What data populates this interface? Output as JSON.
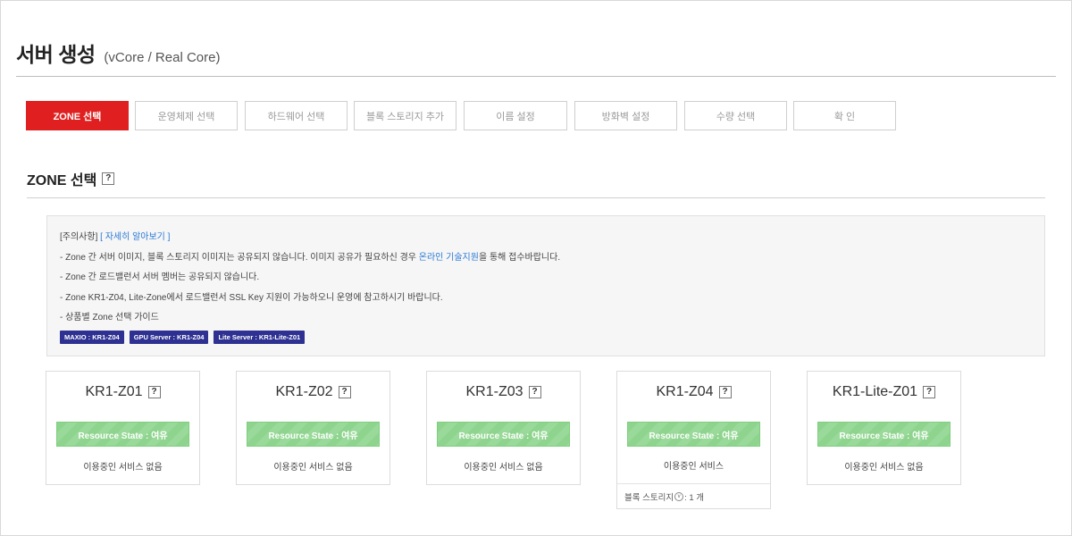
{
  "header": {
    "title": "서버 생성",
    "subtitle": "(vCore / Real Core)"
  },
  "steps": [
    {
      "label": "ZONE 선택",
      "active": true
    },
    {
      "label": "운영체제 선택",
      "active": false
    },
    {
      "label": "하드웨어 선택",
      "active": false
    },
    {
      "label": "블록 스토리지 추가",
      "active": false
    },
    {
      "label": "이름 설정",
      "active": false
    },
    {
      "label": "방화벽 설정",
      "active": false
    },
    {
      "label": "수량 선택",
      "active": false
    },
    {
      "label": "확 인",
      "active": false
    }
  ],
  "section": {
    "title": "ZONE 선택",
    "help": "?"
  },
  "notice": {
    "heading": "[주의사항]",
    "more_link": "[ 자세히 알아보기 ]",
    "line1_a": "- Zone 간 서버 이미지, 블록 스토리지 이미지는 공유되지 않습니다. 이미지 공유가 필요하신 경우 ",
    "line1_link": "온라인 기술지원",
    "line1_b": "을 통해 접수바랍니다.",
    "line2": "- Zone 간 로드밸런서 서버 멤버는 공유되지 않습니다.",
    "line3": "- Zone KR1-Z04, Lite-Zone에서 로드밸런서 SSL Key 지원이 가능하오니 운영에 참고하시기 바랍니다.",
    "line4": "- 상품별 Zone 선택 가이드",
    "badges": [
      "MAXIO : KR1-Z04",
      "GPU Server : KR1-Z04",
      "Lite Server : KR1-Lite-Z01"
    ]
  },
  "zones": [
    {
      "name": "KR1-Z01",
      "help": "?",
      "state": "Resource State : 여유",
      "service": "이용중인 서비스 없음"
    },
    {
      "name": "KR1-Z02",
      "help": "?",
      "state": "Resource State : 여유",
      "service": "이용중인 서비스 없음"
    },
    {
      "name": "KR1-Z03",
      "help": "?",
      "state": "Resource State : 여유",
      "service": "이용중인 서비스 없음"
    },
    {
      "name": "KR1-Z04",
      "help": "?",
      "state": "Resource State : 여유",
      "service": "이용중인 서비스",
      "extra_label": "블록 스토리지",
      "extra_icon": "v",
      "extra_value": ": 1 개"
    },
    {
      "name": "KR1-Lite-Z01",
      "help": "?",
      "state": "Resource State : 여유",
      "service": "이용중인 서비스 없음"
    }
  ],
  "colors": {
    "active_step": "#e02020",
    "state_green": "#8ed48e",
    "badge_navy": "#2e3192",
    "link_blue": "#2a7ad5"
  }
}
